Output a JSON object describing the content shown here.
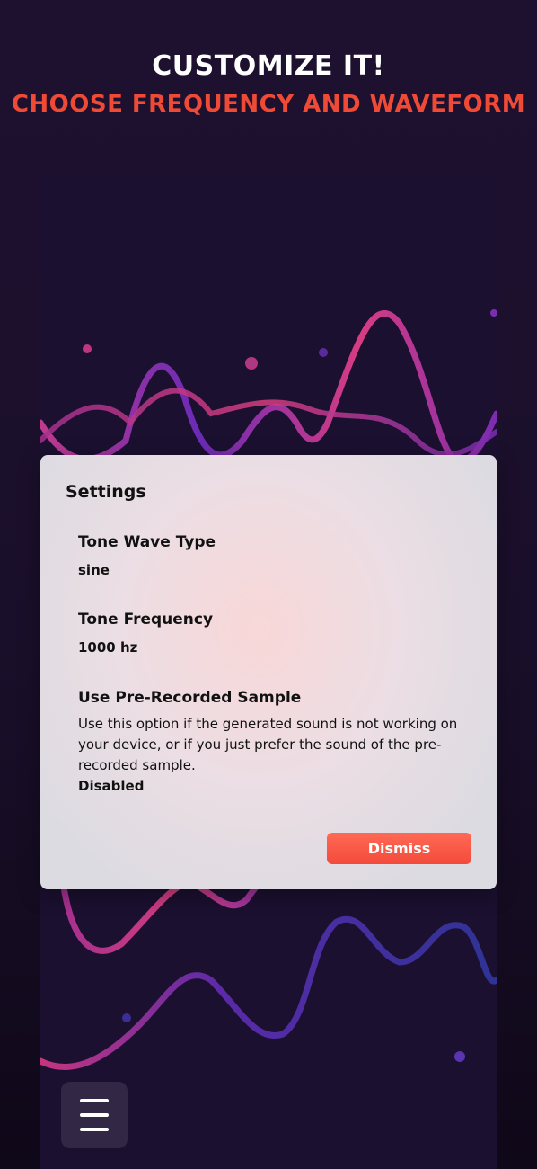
{
  "header": {
    "title": "CUSTOMIZE IT!",
    "subtitle": "CHOOSE FREQUENCY AND WAVEFORM"
  },
  "colors": {
    "background": "#1e1130",
    "accent": "#ef4a35",
    "dialog_bg": "#dcdae0",
    "dismiss_button": "#f34a3b",
    "wave_pink": "#d53c86",
    "wave_purple": "#6b2bb8",
    "wave_blue": "#3a2f9a"
  },
  "settings_dialog": {
    "title": "Settings",
    "items": [
      {
        "label": "Tone Wave Type",
        "value": "sine"
      },
      {
        "label": "Tone Frequency",
        "value": "1000 hz"
      },
      {
        "label": "Use Pre-Recorded Sample",
        "description": "Use this option if the generated sound is not working on your device, or if you just prefer the sound of the pre-recorded sample.",
        "value": "Disabled"
      }
    ],
    "dismiss_label": "Dismiss"
  },
  "menu": {
    "icon": "hamburger-menu-icon"
  }
}
